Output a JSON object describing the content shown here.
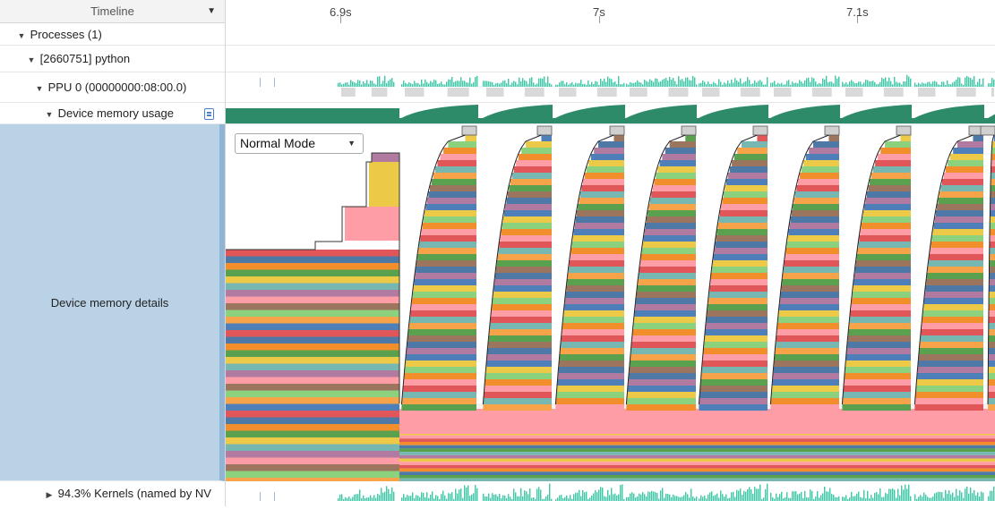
{
  "timeline_header": {
    "title": "Timeline",
    "dropdown_icon": "caret-down-icon"
  },
  "ruler": {
    "ticks": [
      "6.9s",
      "7s",
      "7.1s"
    ]
  },
  "tree": {
    "processes": "Processes (1)",
    "process": "[2660751] python",
    "device": "PPU 0 (00000000:08:00.0)",
    "memory_usage": "Device memory usage",
    "memory_details": "Device memory details",
    "kernels": "94.3% Kernels (named by NV"
  },
  "mode_select": {
    "value": "Normal Mode"
  },
  "colors": {
    "activity": "#3fc8a8",
    "memory_usage": "#2e8b6a",
    "selection": "#b9d2e6",
    "stripes": [
      "#e15759",
      "#4e79a7",
      "#f28e2b",
      "#59a14f",
      "#edc948",
      "#76b7b2",
      "#b07aa1",
      "#ff9da7",
      "#9c755f",
      "#8cd17d",
      "#f7a34a",
      "#4f7fb9"
    ]
  }
}
